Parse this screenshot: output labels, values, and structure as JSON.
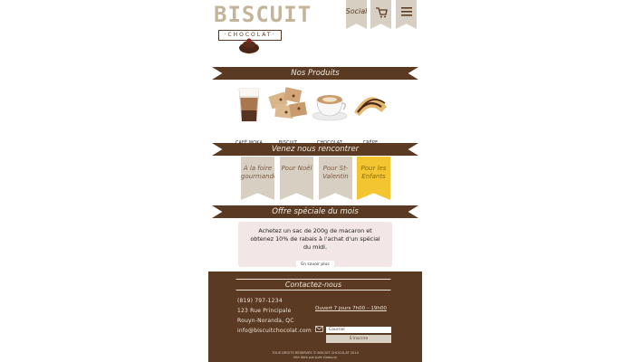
{
  "header": {
    "logo_word": "BISCUIT",
    "logo_sub": "·CHOCOLAT·",
    "social_label": "Social",
    "cart_icon": "cart-icon",
    "menu_icon": "hamburger-menu-icon"
  },
  "products": {
    "title": "Nos Produits",
    "items": [
      {
        "label": "CAFÉ MOKA"
      },
      {
        "label": "BISCUIT"
      },
      {
        "label": "CHOCOLAT CHAUD"
      },
      {
        "label": "CRÊPE"
      }
    ]
  },
  "events": {
    "title": "Venez nous rencontrer",
    "flags": [
      {
        "label": "À la foire gourmande",
        "color": "#d8cfc3"
      },
      {
        "label": "Pour Noël",
        "color": "#d8cfc3"
      },
      {
        "label": "Pour St-Valentin",
        "color": "#d8cfc3"
      },
      {
        "label": "Pour les Enfants",
        "color": "#f3c530"
      }
    ]
  },
  "offer": {
    "title": "Offre spéciale du mois",
    "text": "Achetez un sac de 200g de macaron et obtenez 10% de rabais à l'achat d'un spécial du midi.",
    "button": "En savoir plus"
  },
  "contact": {
    "title": "Contactez-nous",
    "phone": "(819) 797-1234",
    "address": "123 Rue Principale",
    "city": "Rouyn-Noranda, QC",
    "email": "info@biscuitchocolat.com",
    "hours": "Ouvert 7 jours 7h00 – 19h00",
    "email_placeholder": "Courriel",
    "subscribe": "S'inscrire"
  },
  "footer": {
    "copyright": "TOUS DROITS RÉSERVÉS © BISCUIT CHOCOLAT 2014",
    "credit": "Site Web par Julie Gadoury"
  },
  "colors": {
    "brown": "#5a3a22",
    "beige": "#d8cfc3",
    "yellow": "#f3c530",
    "offer_bg": "#f2e6e6"
  }
}
